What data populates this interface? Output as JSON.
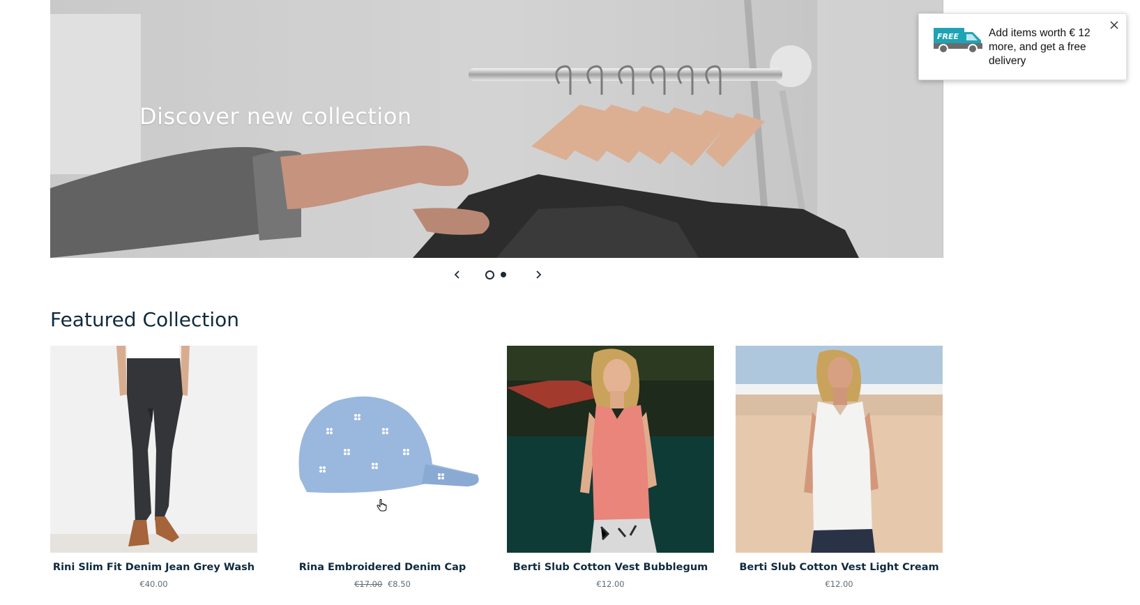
{
  "hero": {
    "heading": "Discover new collection"
  },
  "slider": {
    "prev_icon": "chevron-left-icon",
    "next_icon": "chevron-right-icon",
    "slide_count": 2,
    "active_slide": 1
  },
  "featured": {
    "title": "Featured Collection",
    "products": [
      {
        "name": "Rini Slim Fit Denim Jean Grey Wash",
        "price": "€40.00",
        "old_price": ""
      },
      {
        "name": "Rina Embroidered Denim Cap",
        "price": "€8.50",
        "old_price": "€17.00"
      },
      {
        "name": "Berti Slub Cotton Vest Bubblegum",
        "price": "€12.00",
        "old_price": ""
      },
      {
        "name": "Berti Slub Cotton Vest Light Cream",
        "price": "€12.00",
        "old_price": ""
      }
    ]
  },
  "popup": {
    "badge": "FREE",
    "message": "Add items worth € 12 more, and get a free delivery",
    "close_icon": "close-icon"
  },
  "colors": {
    "text": "#0f2a3d",
    "accent_teal": "#1ea3b5",
    "truck_grey": "#6b6b6b"
  }
}
